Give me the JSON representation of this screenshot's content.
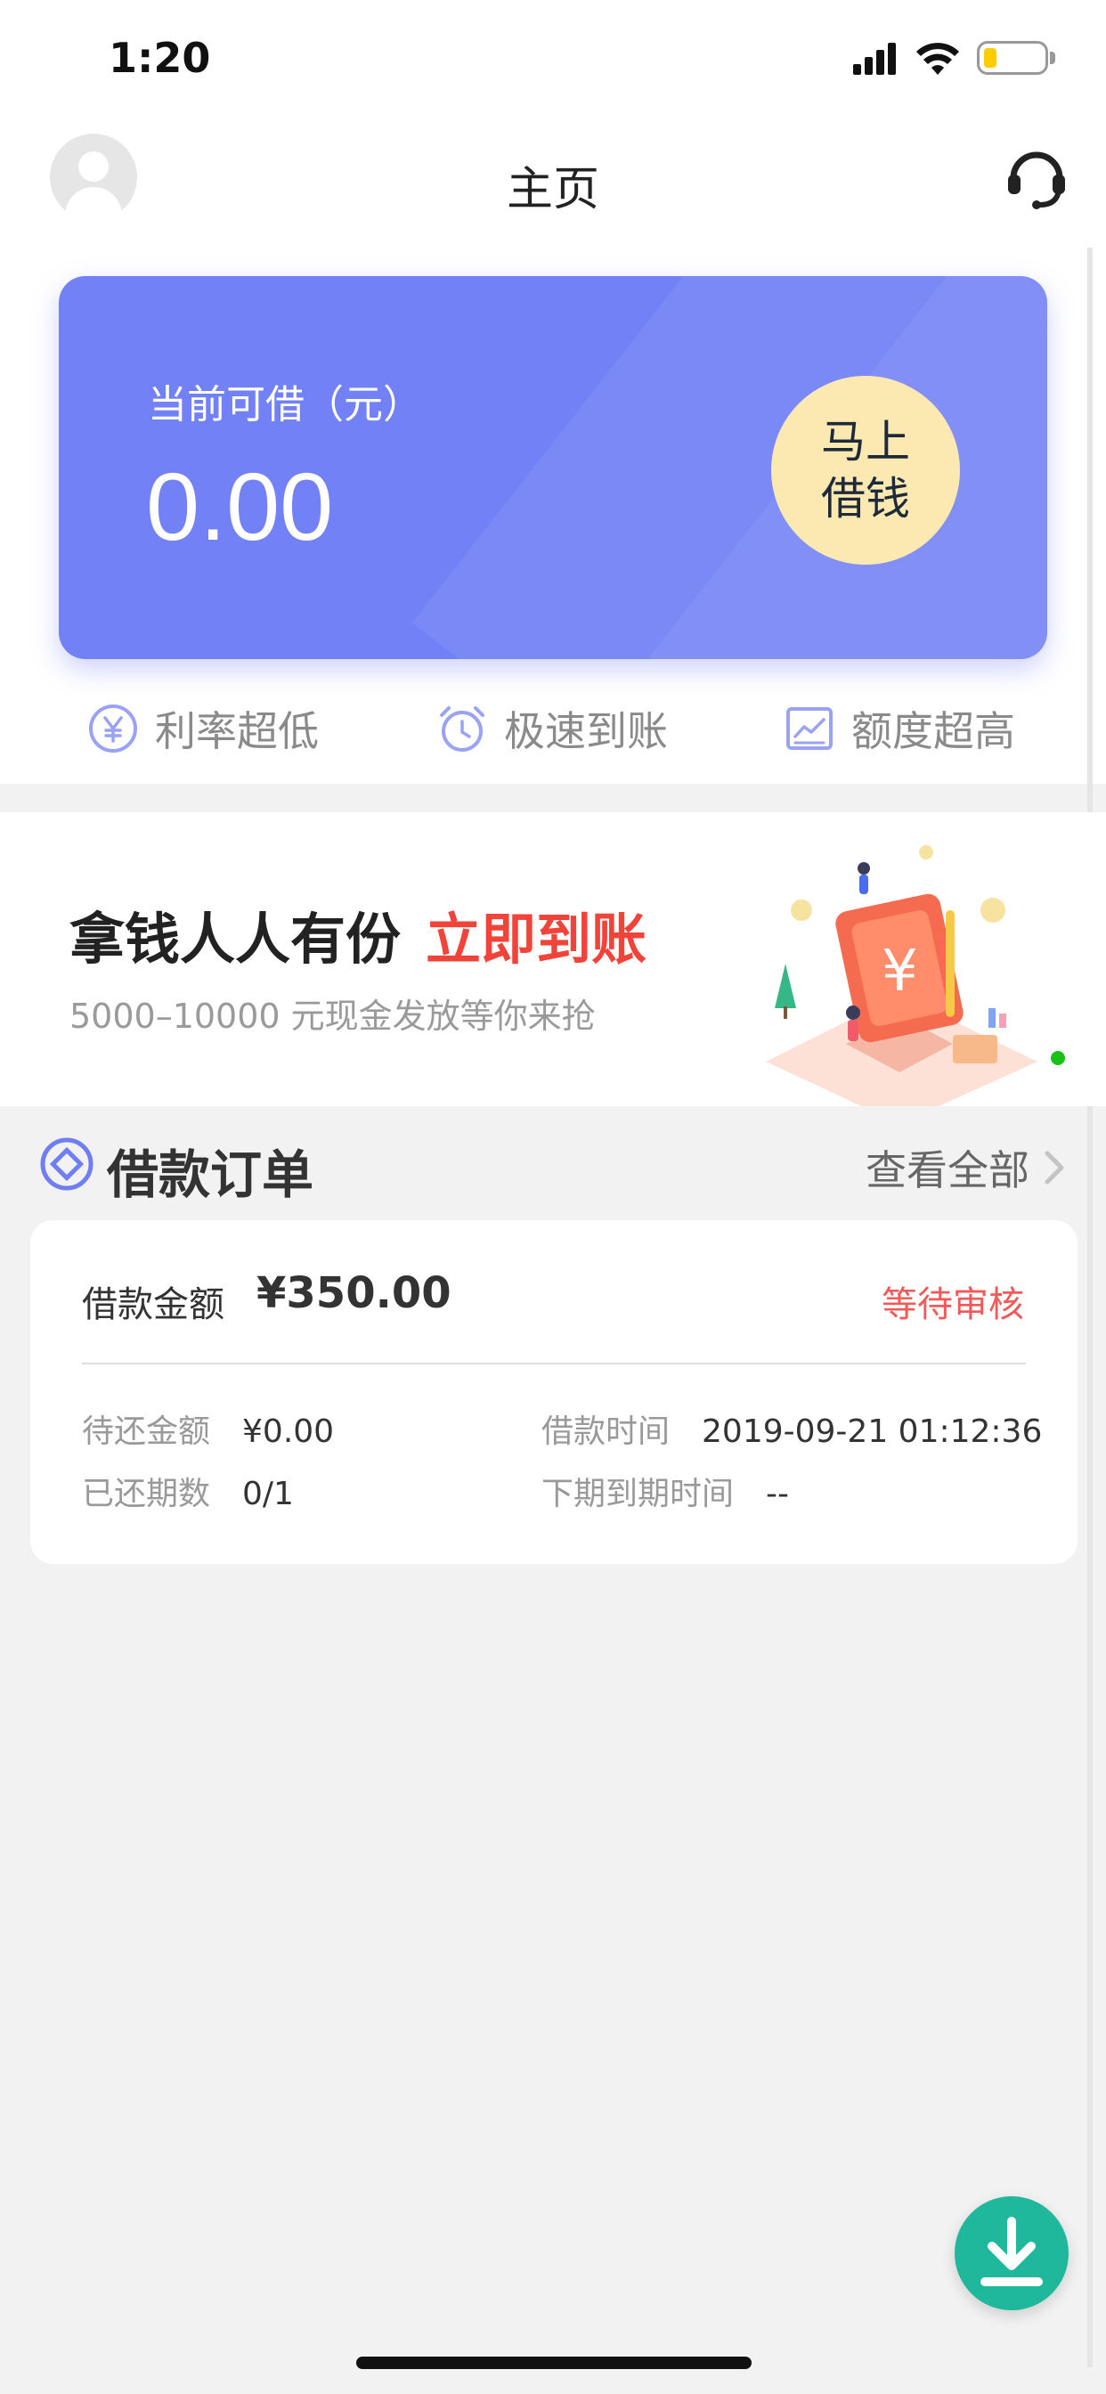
{
  "status_bar": {
    "time": "1:20"
  },
  "header": {
    "title": "主页"
  },
  "loan_card": {
    "label": "当前可借（元）",
    "amount": "0.00",
    "button_label": "马上借钱"
  },
  "features": [
    {
      "label": "利率超低",
      "icon": "yen-circle-icon"
    },
    {
      "label": "极速到账",
      "icon": "alarm-clock-icon"
    },
    {
      "label": "额度超高",
      "icon": "trend-chart-icon"
    }
  ],
  "banner": {
    "title": "拿钱人人有份",
    "highlight": "立即到账",
    "subtitle": "5000–10000 元现金发放等你来抢"
  },
  "orders": {
    "title": "借款订单",
    "view_all": "查看全部",
    "order": {
      "amount_label": "借款金额",
      "amount": "¥350.00",
      "status": "等待审核",
      "pending_label": "待还金额",
      "pending_value": "¥0.00",
      "time_label": "借款时间",
      "time_value": "2019-09-21 01:12:36",
      "periods_label": "已还期数",
      "periods_value": "0/1",
      "next_due_label": "下期到期时间",
      "next_due_value": "--"
    }
  },
  "colors": {
    "card": "#7282f6",
    "button": "#fbe9b1",
    "highlight": "#f0443b",
    "status": "#f25a5a",
    "fab": "#1fb89d"
  }
}
